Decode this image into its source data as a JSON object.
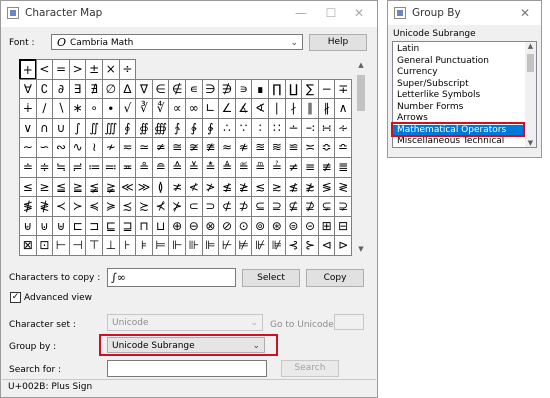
{
  "charmap": {
    "title": "Character Map",
    "controls": {
      "minimize": "—",
      "maximize": "☐",
      "close": "✕"
    },
    "font_label": "Font :",
    "font_value": "Cambria Math",
    "help_label": "Help",
    "characters_to_copy_label": "Characters to copy :",
    "characters_to_copy_value": "∫∞",
    "select_label": "Select",
    "copy_label": "Copy",
    "advanced_view_label": "Advanced view",
    "advanced_view_checked": true,
    "character_set_label": "Character set :",
    "character_set_value": "Unicode",
    "go_to_unicode_label": "Go to Unicode :",
    "go_to_unicode_value": "",
    "group_by_label": "Group by :",
    "group_by_value": "Unicode Subrange",
    "search_for_label": "Search for :",
    "search_value": "",
    "search_button_label": "Search",
    "status_text": "U+002B: Plus Sign",
    "selected_char": "+",
    "grid": [
      "+<=>±×÷",
      "∀∁∂∃∄∅∆∇∈∉∊∋∌∍∎∏∐∑−∓",
      "∔∕∖∗∘∙√∛∜∝∞∟∠∡∢∣∤∥∦∧",
      "∨∩∪∫∬∭∮∯∰∱∲∳∴∵∶∷∸∹∺∻",
      "∼∽∾∿≀≁≂≃≄≅≆≇≈≉≊≋≌≍≎≏",
      "≐≑≒≓≔≕≖≗≘≙≚≛≜≝≞≟≠≡≢≣",
      "≤≥≦≧≨≩≪≫≬≭≮≯≰≱≲≳≴≵≶≷",
      "≸≹≺≻≼≽≾≿⊀⊁⊂⊃⊄⊅⊆⊇⊈⊉⊊⊋",
      "⊌⊍⊎⊏⊐⊑⊒⊓⊔⊕⊖⊗⊘⊙⊚⊛⊜⊝⊞⊟",
      "⊠⊡⊢⊣⊤⊥⊦⊧⊨⊩⊪⊫⊬⊭⊮⊯⊰⊱⊲⊳"
    ]
  },
  "groupby": {
    "title": "Group By",
    "close": "✕",
    "header": "Unicode Subrange",
    "items": [
      "Latin",
      "General Punctuation",
      "Currency",
      "Super/Subscript",
      "Letterlike Symbols",
      "Number Forms",
      "Arrows",
      "Mathematical Operators",
      "Miscellaneous Technical"
    ],
    "selected_item": "Mathematical Operators"
  },
  "colors": {
    "highlight_box": "#cc1122",
    "selection": "#0078d7"
  }
}
